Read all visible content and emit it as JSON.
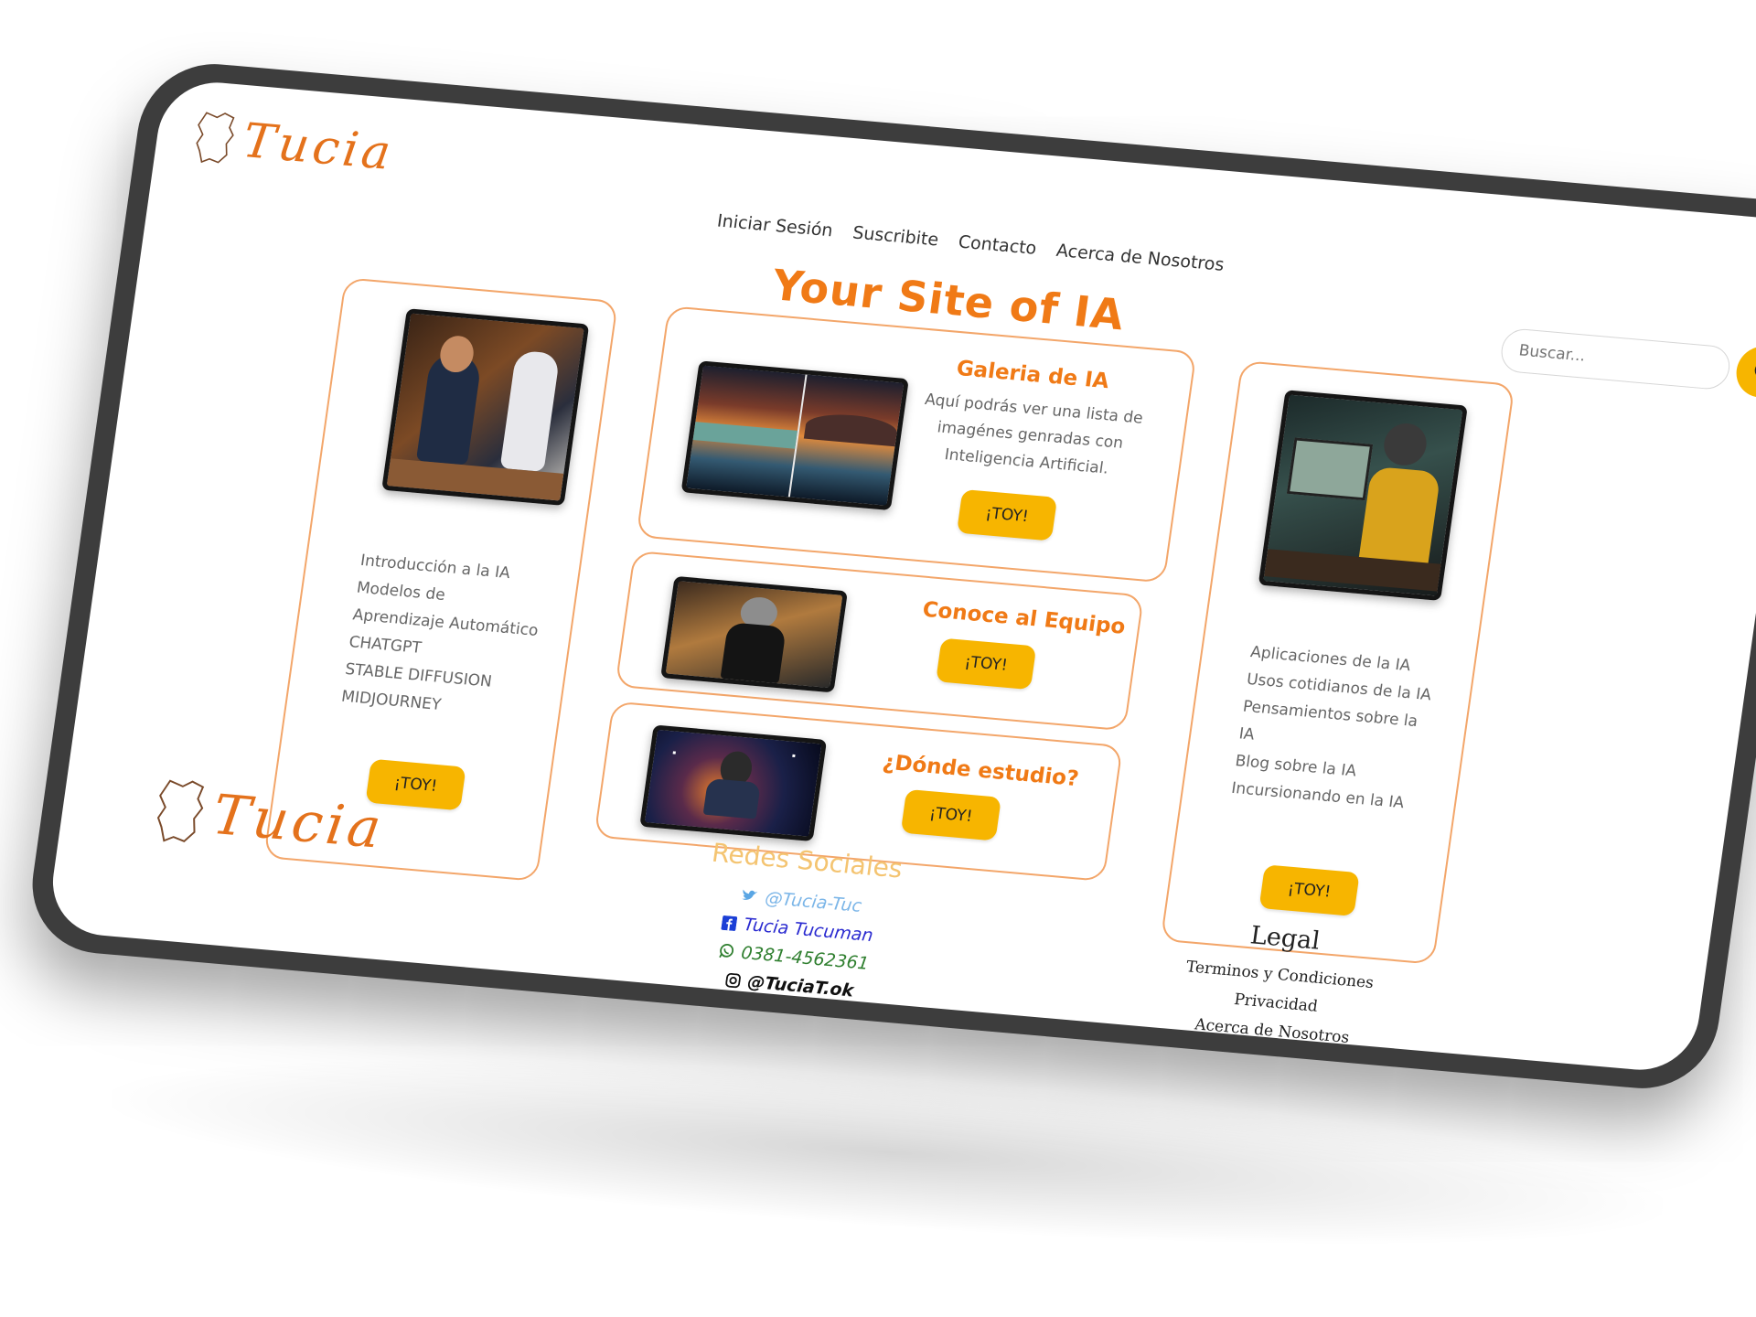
{
  "brand": {
    "name": "Tucia"
  },
  "nav": {
    "items": [
      "Iniciar Sesión",
      "Suscribite",
      "Contacto",
      "Acerca de Nosotros"
    ]
  },
  "search": {
    "placeholder": "Buscar..."
  },
  "page": {
    "title": "Your Site of IA"
  },
  "cards": {
    "left": {
      "items": [
        "Introducción a la IA",
        "Modelos de",
        "Aprendizaje Automático",
        "CHATGPT",
        "STABLE DIFFUSION",
        "MIDJOURNEY"
      ],
      "button": "¡TOY!"
    },
    "gallery": {
      "title": "Galeria de IA",
      "text": "Aquí podrás ver una lista de imagénes genradas con Inteligencia Artificial.",
      "button": "¡TOY!"
    },
    "team": {
      "title": "Conoce al Equipo",
      "button": "¡TOY!"
    },
    "study": {
      "title": "¿Dónde estudio?",
      "button": "¡TOY!"
    },
    "right": {
      "items": [
        "Aplicaciones de la IA",
        "Usos cotidianos de la IA",
        "Pensamientos sobre la",
        "IA",
        "Blog sobre la IA",
        "Incursionando en la IA"
      ],
      "button": "¡TOY!"
    }
  },
  "footer": {
    "social": {
      "title": "Redes Sociales",
      "twitter": "@Tucia-Tuc",
      "facebook": "Tucia Tucuman",
      "whatsapp": "0381-4562361",
      "instagram": "@TuciaT.ok"
    },
    "legal": {
      "title": "Legal",
      "links": [
        "Terminos y Condiciones",
        "Privacidad",
        "Acerca de Nosotros"
      ]
    }
  },
  "colors": {
    "accent": "#f07a16",
    "button": "#f7b500",
    "card_border": "#f3a66a",
    "device_frame": "#3d3d3d",
    "social_title": "#f4c471",
    "twitter": "#7cb6e8",
    "facebook": "#2a2ad0",
    "whatsapp": "#2f7f2f"
  },
  "icons": {
    "logo": "tucuman-map-outline-icon",
    "search": "magnifier-icon",
    "twitter": "twitter-bird-icon",
    "facebook": "facebook-icon",
    "whatsapp": "whatsapp-icon",
    "instagram": "instagram-icon"
  }
}
